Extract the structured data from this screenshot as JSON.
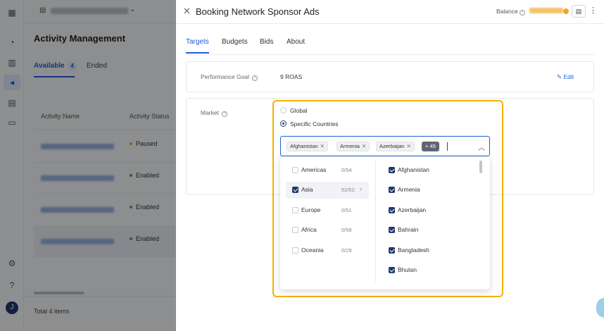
{
  "app": {
    "page_title": "Activity Management",
    "tabs": [
      {
        "label": "Available",
        "count": "4"
      },
      {
        "label": "Ended"
      }
    ],
    "table": {
      "headers": [
        "Activity Name",
        "Activity Status"
      ],
      "rows": [
        {
          "status": "Paused",
          "status_color": "#f5a623"
        },
        {
          "status": "Enabled",
          "status_color": "#2fb36b"
        },
        {
          "status": "Enabled",
          "status_color": "#2fb36b"
        },
        {
          "status": "Enabled",
          "status_color": "#2fb36b"
        }
      ]
    },
    "footer": "Total 4 items",
    "avatar_initial": "J",
    "accent_color": "#1a5fd6"
  },
  "drawer": {
    "title": "Booking Network Sponsor Ads",
    "balance_label": "Balance",
    "tabs": [
      "Targets",
      "Budgets",
      "Bids",
      "About"
    ],
    "active_tab": "Targets",
    "performance_goal": {
      "label": "Performance Goal",
      "value": "9 ROAS",
      "edit_label": "Edit"
    },
    "market": {
      "label": "Market",
      "options": [
        {
          "label": "Global",
          "selected": false
        },
        {
          "label": "Specific Countries",
          "selected": true
        }
      ],
      "selected_chips": [
        "Afghanistan",
        "Armenia",
        "Azerbaijan"
      ],
      "more_count": "+ 49",
      "regions": [
        {
          "name": "Americas",
          "count": "0/54",
          "checked": false
        },
        {
          "name": "Asia",
          "count": "52/52",
          "checked": true
        },
        {
          "name": "Europe",
          "count": "0/51",
          "checked": false
        },
        {
          "name": "Africa",
          "count": "0/58",
          "checked": false
        },
        {
          "name": "Oceania",
          "count": "0/29",
          "checked": false
        }
      ],
      "countries": [
        {
          "name": "Afghanistan",
          "checked": true
        },
        {
          "name": "Armenia",
          "checked": true
        },
        {
          "name": "Azerbaijan",
          "checked": true
        },
        {
          "name": "Bahrain",
          "checked": true
        },
        {
          "name": "Bangladesh",
          "checked": true
        },
        {
          "name": "Bhutan",
          "checked": true
        }
      ]
    }
  }
}
